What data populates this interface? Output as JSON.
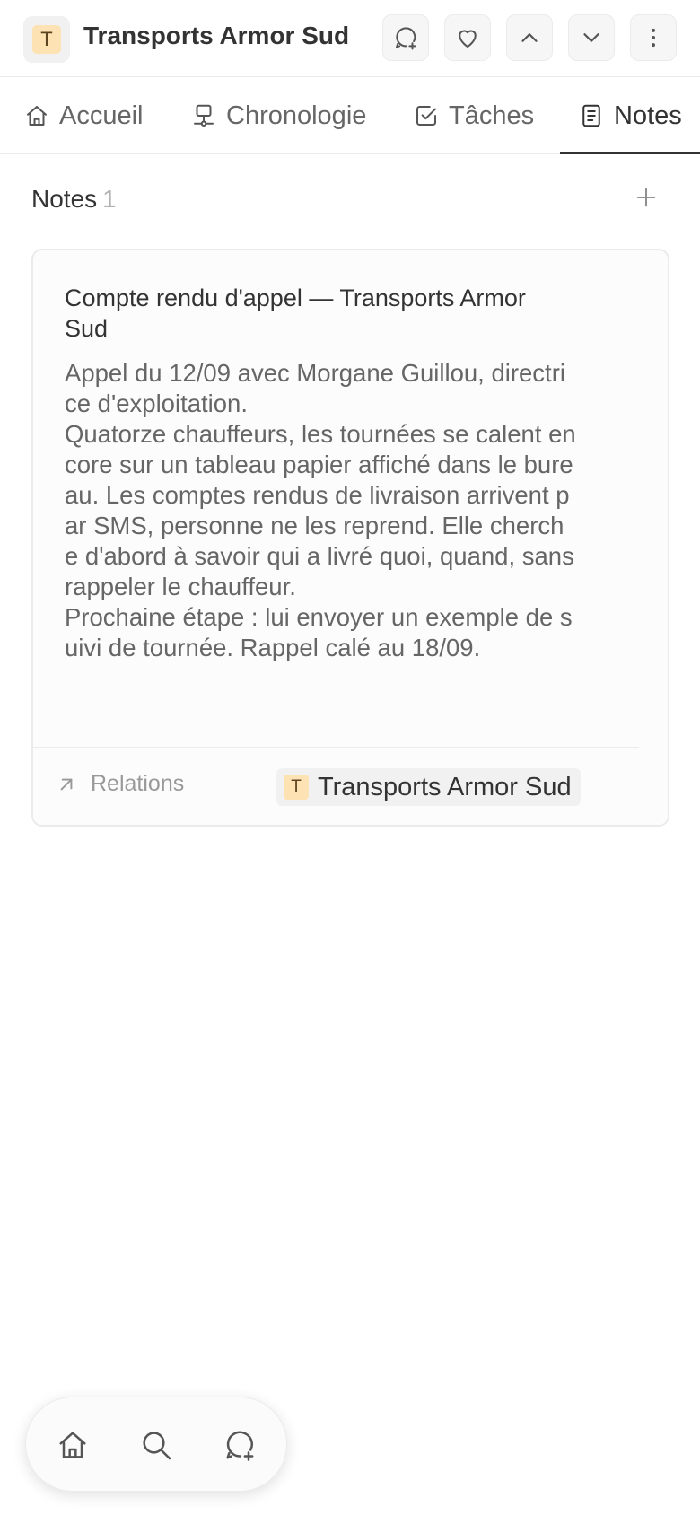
{
  "header": {
    "avatar_letter": "T",
    "title": "Transports Armor Sud",
    "actions": [
      {
        "name": "new-comment-button",
        "icon": "comment-plus-icon"
      },
      {
        "name": "favorite-button",
        "icon": "heart-icon"
      },
      {
        "name": "previous-record-button",
        "icon": "chevron-up-icon"
      },
      {
        "name": "next-record-button",
        "icon": "chevron-down-icon"
      },
      {
        "name": "more-options-button",
        "icon": "dots-vertical-icon"
      }
    ]
  },
  "tabs": [
    {
      "label": "Accueil",
      "icon": "home-icon",
      "active": false
    },
    {
      "label": "Chronologie",
      "icon": "timeline-icon",
      "active": false
    },
    {
      "label": "Tâches",
      "icon": "checkbox-icon",
      "active": false
    },
    {
      "label": "Notes",
      "icon": "note-icon",
      "active": true
    }
  ],
  "notes": {
    "heading": "Notes",
    "count": "1",
    "items": [
      {
        "title": "Compte rendu d'appel — Transports Armor Sud",
        "body": "Appel du 12/09 avec Morgane Guillou, directrice d'exploitation.\nQuatorze chauffeurs, les tournées se calent encore sur un tableau papier affiché dans le bureau. Les comptes rendus de livraison arrivent par SMS, personne ne les reprend. Elle cherche d'abord à savoir qui a livré quoi, quand, sans rappeler le chauffeur.\nProchaine étape : lui envoyer un exemple de suivi de tournée. Rappel calé au 18/09.",
        "relations_label": "Relations",
        "relation": {
          "letter": "T",
          "name": "Transports Armor Sud"
        }
      }
    ]
  },
  "bottom_nav": [
    {
      "name": "home-nav-button",
      "icon": "home-icon"
    },
    {
      "name": "search-nav-button",
      "icon": "search-icon"
    },
    {
      "name": "new-comment-nav-button",
      "icon": "comment-plus-icon"
    }
  ],
  "colors": {
    "avatar_bg": "#fde3b3",
    "text_primary": "#333333",
    "text_secondary": "#666666",
    "border": "#ebebeb"
  }
}
